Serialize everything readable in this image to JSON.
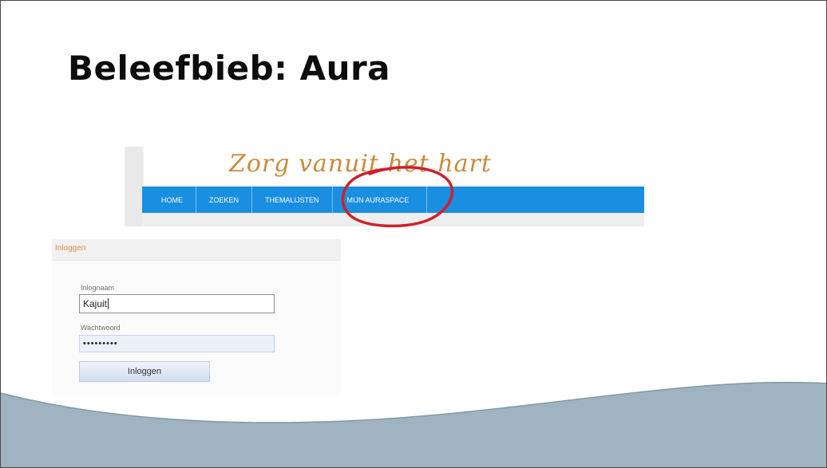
{
  "slide": {
    "title": "Beleefbieb: Aura"
  },
  "site_header": {
    "tagline": "Zorg vanuit het hart",
    "nav_items": [
      {
        "label": "HOME"
      },
      {
        "label": "ZOEKEN"
      },
      {
        "label": "THEMALIJSTEN"
      },
      {
        "label": "MIJN AURASPACE"
      }
    ]
  },
  "login": {
    "header_label": "Inloggen",
    "username_label": "Inlognaam",
    "username_value": "Kajuit",
    "password_label": "Wachtwoord",
    "password_value": "•••••••••",
    "submit_label": "Inloggen"
  },
  "colors": {
    "nav_bar": "#1a8ee0",
    "tagline": "#c98a3b",
    "highlight": "#d0202a",
    "footer_wave": "#9fb3c0",
    "login_header_text": "#e58a4a"
  }
}
